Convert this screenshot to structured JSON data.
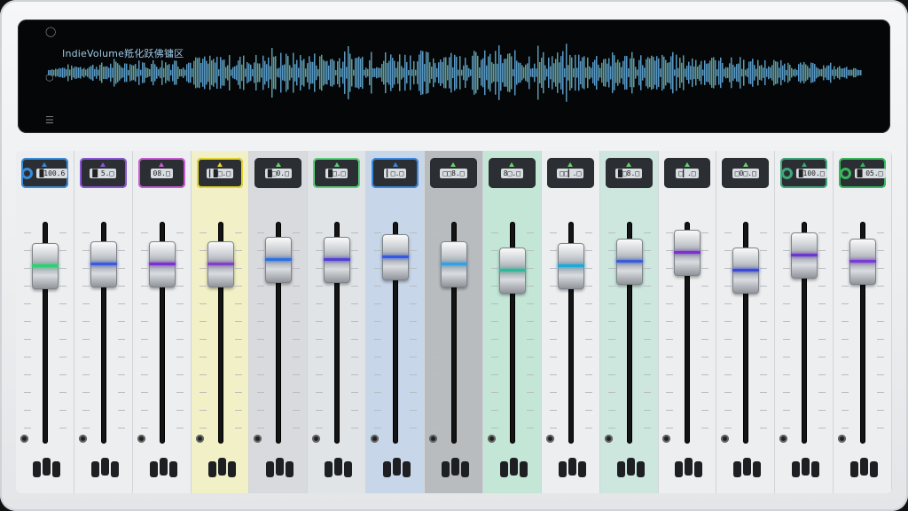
{
  "waveform": {
    "title": "IndieVolume羝化跃佛镛区",
    "side_icons": [
      "power-icon",
      "settings-icon",
      "menu-icon"
    ]
  },
  "channels": [
    {
      "label": "█100.6",
      "tint": "#eceef0",
      "accent": "#3a8bd8",
      "line": "#2fcf76",
      "level": 0.4
    },
    {
      "label": "█▎5.□",
      "tint": "#eceef0",
      "accent": "#8a55d6",
      "line": "#3a59e0",
      "level": 0.41
    },
    {
      "label": "08.□",
      "tint": "#eceef0",
      "accent": "#c65bd3",
      "line": "#7b2fd4",
      "level": 0.41
    },
    {
      "label": "▎█□.□",
      "tint": "#f1f0c6",
      "accent": "#e3d530",
      "line": "#8040c6",
      "level": 0.41
    },
    {
      "label": "█□0.□",
      "tint": "#d8dadd",
      "accent": "#2a2d31",
      "line": "#2f6fe0",
      "level": 0.43
    },
    {
      "label": "█□.□",
      "tint": "#e0e4e7",
      "accent": "#5bcf7a",
      "line": "#5340d6",
      "level": 0.43
    },
    {
      "label": "▎□.□",
      "tint": "#c7d6e8",
      "accent": "#3a88e0",
      "line": "#3458e6",
      "level": 0.44
    },
    {
      "label": "□□8.□",
      "tint": "#b9bcbf",
      "accent": "#2a2d31",
      "line": "#34a0e0",
      "level": 0.41
    },
    {
      "label": "8□.□",
      "tint": "#c3e6d7",
      "accent": "#2a2d31",
      "line": "#2cba9a",
      "level": 0.38
    },
    {
      "label": "□□▎.□",
      "tint": "#eceef0",
      "accent": "#2a2d31",
      "line": "#1fa8d8",
      "level": 0.4
    },
    {
      "label": "█□8.□",
      "tint": "#cde7df",
      "accent": "#2a2d31",
      "line": "#3a5cd6",
      "level": 0.42
    },
    {
      "label": "□▎.□",
      "tint": "#eceef0",
      "accent": "#2a2d31",
      "line": "#7a33cf",
      "level": 0.46
    },
    {
      "label": "□0□.□",
      "tint": "#eceef0",
      "accent": "#2a2d31",
      "line": "#3a49d8",
      "level": 0.38
    },
    {
      "label": "█100.□",
      "tint": "#eceef0",
      "accent": "#3ea77a",
      "line": "#6b35cf",
      "level": 0.45
    },
    {
      "label": "█▎05.□",
      "tint": "#eceef0",
      "accent": "#36b85a",
      "line": "#7b3ad6",
      "level": 0.42
    }
  ]
}
